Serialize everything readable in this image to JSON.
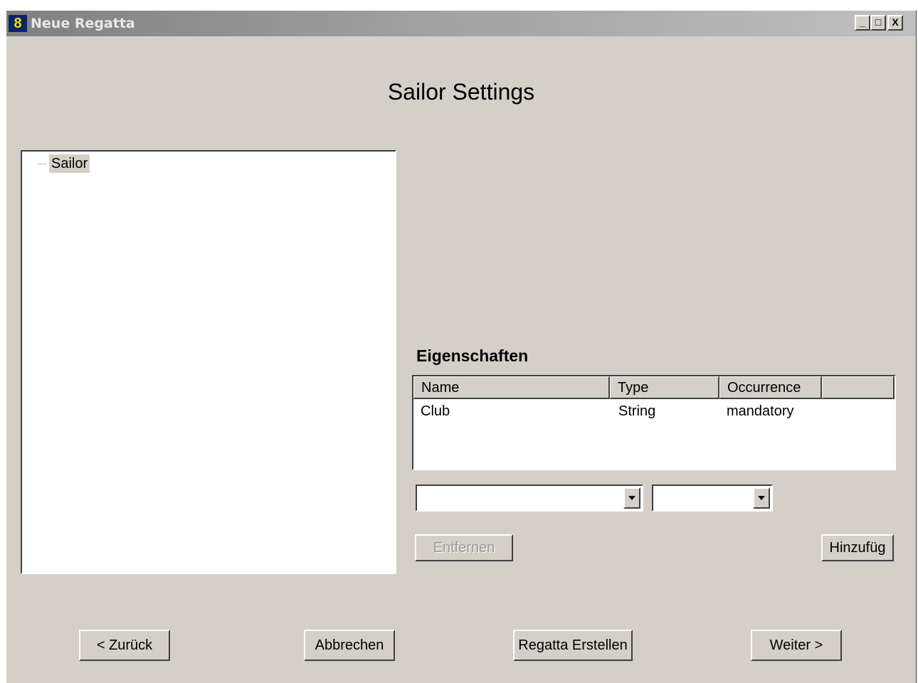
{
  "window": {
    "title": "Neue Regatta",
    "icon": "8",
    "controls": {
      "minimize": "_",
      "maximize": "□",
      "close": "X"
    }
  },
  "page": {
    "title": "Sailor Settings"
  },
  "tree": {
    "items": [
      {
        "label": "Sailor",
        "selected": true
      }
    ]
  },
  "properties": {
    "label": "Eigenschaften",
    "columns": [
      "Name",
      "Type",
      "Occurrence",
      ""
    ],
    "rows": [
      {
        "name": "Club",
        "type": "String",
        "occurrence": "mandatory"
      }
    ]
  },
  "combos": {
    "type_value": "",
    "occurrence_value": ""
  },
  "actions": {
    "remove_label": "Entfernen",
    "remove_enabled": false,
    "add_label": "Hinzufüg"
  },
  "footer": {
    "back_label": "<  Zurück",
    "cancel_label": "Abbrechen",
    "create_label": "Regatta Erstellen",
    "next_label": "Weiter  >"
  },
  "colors": {
    "window_bg": "#d4d0c8",
    "titlebar_start": "#808080",
    "titlebar_end": "#c0c0c0"
  }
}
